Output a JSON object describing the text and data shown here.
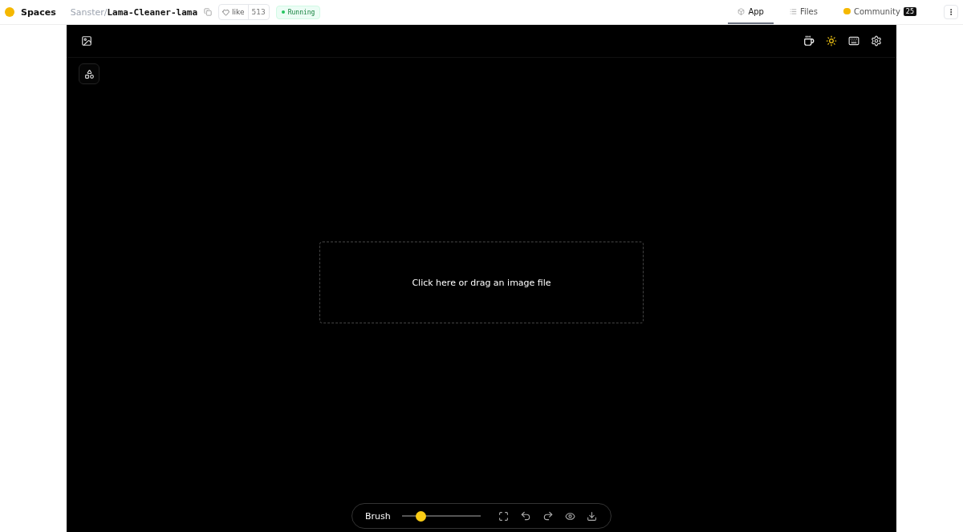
{
  "header": {
    "brand": "Spaces",
    "owner": "Sanster",
    "separator": "/",
    "repo": "Lama-Cleaner-lama",
    "like_label": "like",
    "like_count": "513",
    "status": "Running"
  },
  "nav_tabs": [
    {
      "label": "App",
      "selected": true
    },
    {
      "label": "Files",
      "selected": false
    },
    {
      "label": "Community",
      "selected": false,
      "badge": "25"
    }
  ],
  "app": {
    "theme_light_on": true,
    "dropzone": "Click here or drag an image file",
    "toolbar": {
      "brush_label": "Brush",
      "brush": {
        "level": 0.2
      }
    }
  }
}
